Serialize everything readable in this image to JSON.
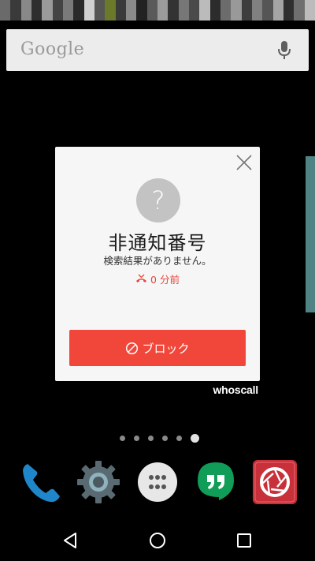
{
  "status_bar": {
    "pixel_colors": [
      "#6a6a6a",
      "#3a3a3a",
      "#888888",
      "#2e2e2e",
      "#9a9a9a",
      "#444444",
      "#7a7a7a",
      "#2a2a2a",
      "#d0d0d0",
      "#555555",
      "#6b7a2a",
      "#3a3a3a",
      "#8a8a8a",
      "#222222",
      "#5a5a5a",
      "#9b9b9b",
      "#333333",
      "#777777",
      "#4a4a4a",
      "#bbbbbb",
      "#2c2c2c",
      "#6c6c6c",
      "#999999",
      "#3d3d3d",
      "#808080",
      "#555555",
      "#a5a5a5",
      "#2f2f2f",
      "#6f6f6f",
      "#bcbcbc"
    ]
  },
  "search": {
    "logo": "Google",
    "mic_icon": "mic-icon"
  },
  "popup": {
    "avatar_glyph": "?",
    "caller_name": "非通知番号",
    "search_result": "検索結果がありません。",
    "call_time": "0 分前",
    "block_label": "ブロック",
    "accent_color": "#f0473a",
    "icons": {
      "close": "close-icon",
      "missed_call": "missed-call-icon",
      "block": "block-icon"
    }
  },
  "branding": {
    "whoscall": "whoscall"
  },
  "home": {
    "pages": 6,
    "current_page": 6
  },
  "dock": {
    "apps": [
      {
        "name": "phone",
        "icon": "phone-icon"
      },
      {
        "name": "settings",
        "icon": "settings-gear-icon"
      },
      {
        "name": "app-drawer",
        "icon": "app-drawer-icon"
      },
      {
        "name": "hangouts",
        "icon": "hangouts-icon"
      },
      {
        "name": "camera",
        "icon": "camera-shutter-icon"
      }
    ]
  },
  "nav": {
    "back": "back-icon",
    "home": "home-icon",
    "recents": "recents-icon"
  }
}
